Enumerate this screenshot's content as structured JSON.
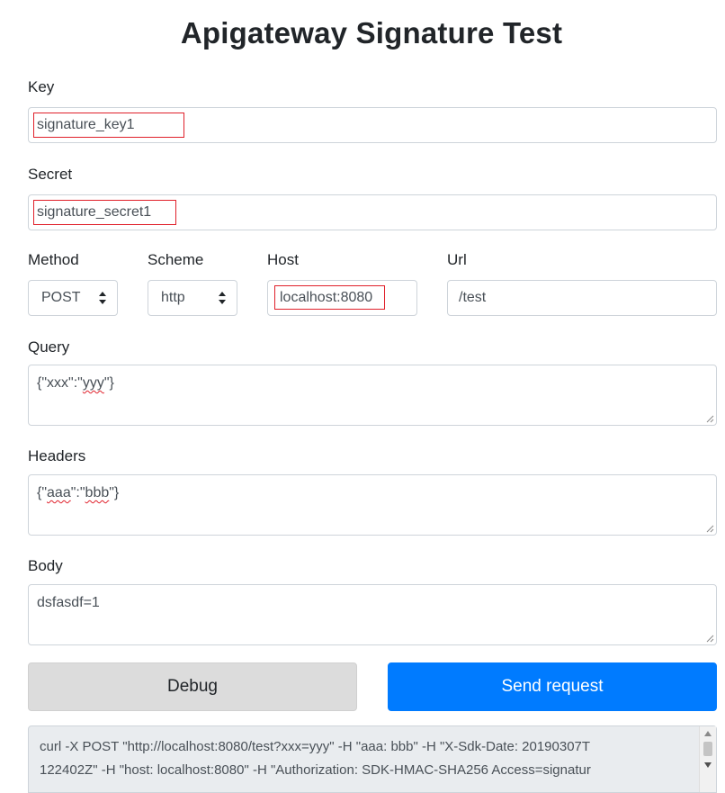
{
  "page": {
    "title": "Apigateway Signature Test"
  },
  "form": {
    "key": {
      "label": "Key",
      "value": "signature_key1"
    },
    "secret": {
      "label": "Secret",
      "value": "signature_secret1"
    },
    "method": {
      "label": "Method",
      "value": "POST"
    },
    "scheme": {
      "label": "Scheme",
      "value": "http"
    },
    "host": {
      "label": "Host",
      "value": "localhost:8080"
    },
    "url": {
      "label": "Url",
      "value": "/test"
    },
    "query": {
      "label": "Query",
      "value_prefix": "{\"xxx\":\"",
      "value_word": "yyy",
      "value_suffix": "\"}"
    },
    "headers": {
      "label": "Headers",
      "value_prefix": "{\"",
      "value_word1": "aaa",
      "value_mid": "\":\"",
      "value_word2": "bbb",
      "value_suffix": "\"}"
    },
    "body": {
      "label": "Body",
      "value": "dsfasdf=1"
    }
  },
  "actions": {
    "debug_label": "Debug",
    "send_label": "Send request"
  },
  "output": {
    "line1": "curl -X POST \"http://localhost:8080/test?xxx=yyy\" -H \"aaa: bbb\" -H \"X-Sdk-Date: 20190307T",
    "line2": "122402Z\" -H \"host: localhost:8080\" -H \"Authorization: SDK-HMAC-SHA256 Access=signatur"
  },
  "colors": {
    "primary": "#007bff",
    "highlight": "#e0202a",
    "debug_bg": "#dcdcdc"
  }
}
